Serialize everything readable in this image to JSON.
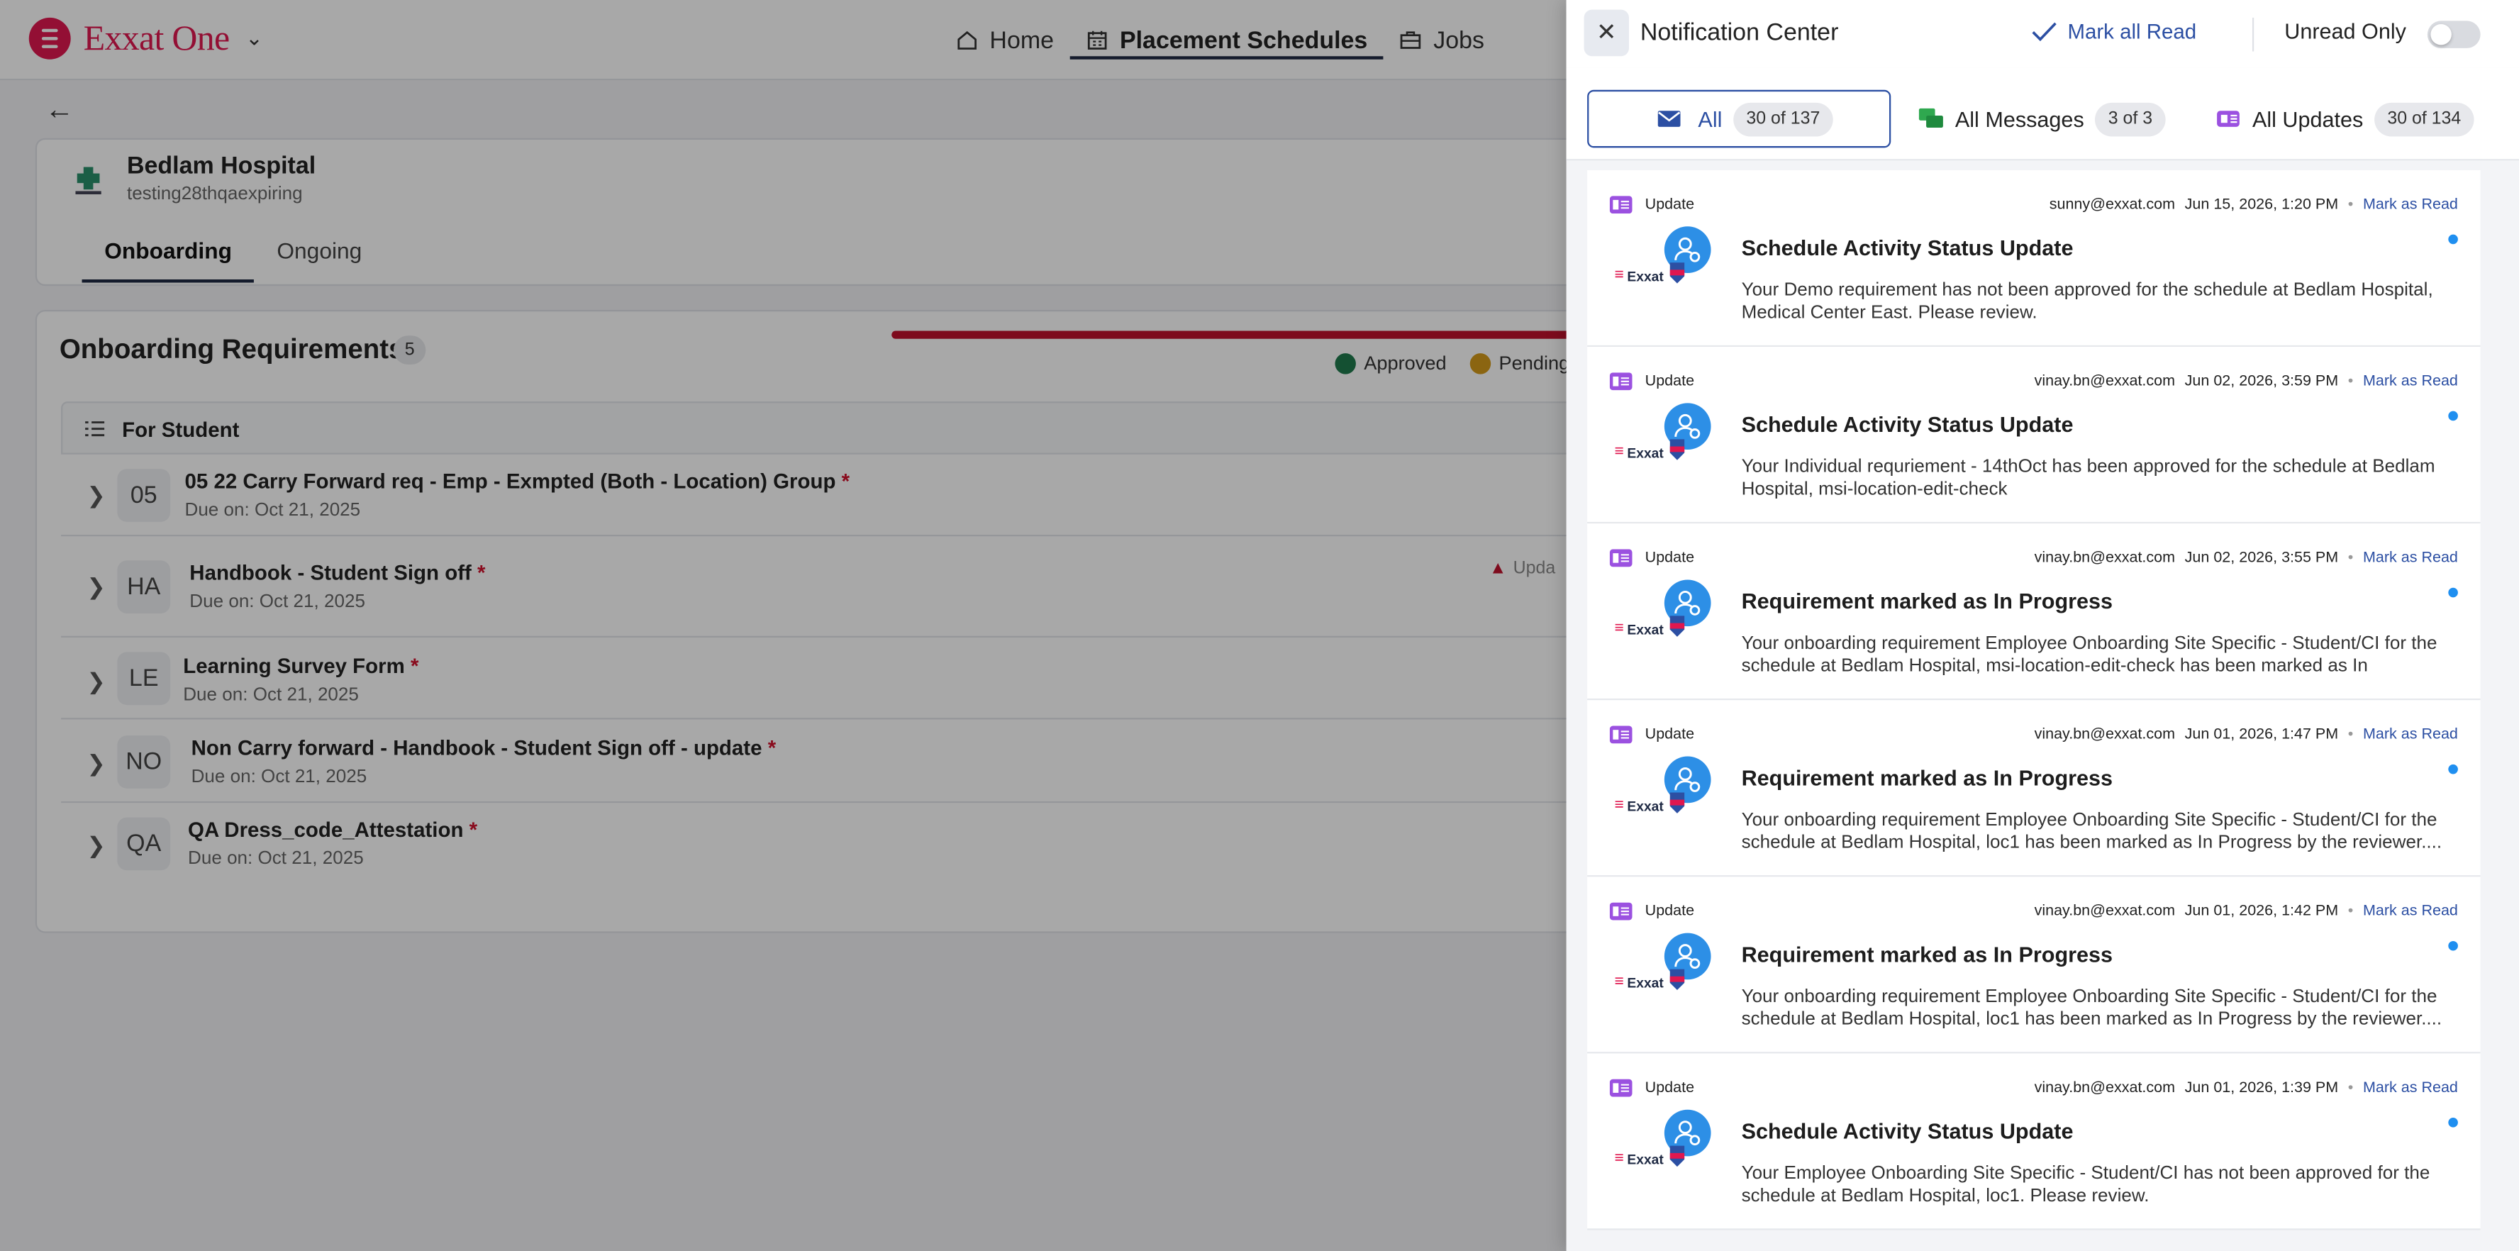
{
  "app": {
    "name": "Exxat One"
  },
  "nav": [
    {
      "label": "Home",
      "icon": "home-icon"
    },
    {
      "label": "Placement Schedules",
      "icon": "calendar-icon"
    },
    {
      "label": "Jobs",
      "icon": "briefcase-icon"
    }
  ],
  "hospital": {
    "name": "Bedlam Hospital",
    "subtitle": "testing28thqaexpiring"
  },
  "tabs": [
    {
      "label": "Onboarding"
    },
    {
      "label": "Ongoing"
    }
  ],
  "requirements": {
    "title": "Onboarding Requirements",
    "count": "5",
    "legend": {
      "approved": "Approved",
      "pending": "Pending"
    },
    "group_label": "For Student",
    "warning_text": "Upda",
    "items": [
      {
        "badge": "05",
        "name": "05 22 Carry Forward req - Emp - Exmpted (Both - Location) Group",
        "required": "*",
        "due": "Due on: Oct 21, 2025"
      },
      {
        "badge": "HA",
        "name": "Handbook - Student Sign off",
        "required": "*",
        "due": "Due on: Oct 21, 2025"
      },
      {
        "badge": "LE",
        "name": "Learning Survey Form",
        "required": "*",
        "due": "Due on: Oct 21, 2025"
      },
      {
        "badge": "NO",
        "name": "Non Carry forward - Handbook - Student Sign off - update",
        "required": "*",
        "due": "Due on: Oct 21, 2025"
      },
      {
        "badge": "QA",
        "name": "QA Dress_code_Attestation",
        "required": "*",
        "due": "Due on: Oct 21, 2025"
      }
    ]
  },
  "drawer": {
    "title": "Notification Center",
    "mark_all": "Mark all Read",
    "unread_only": "Unread Only",
    "unread_only_on": false,
    "filters": [
      {
        "label": "All",
        "count": "30 of 137",
        "active": true
      },
      {
        "label": "All Messages",
        "count": "3 of 3",
        "active": false
      },
      {
        "label": "All Updates",
        "count": "30 of 134",
        "active": false
      }
    ],
    "notifications": [
      {
        "type": "Update",
        "sender": "sunny@exxat.com",
        "time": "Jun 15, 2026, 1:20 PM",
        "action": "Mark as Read",
        "brand": "Exxat",
        "title": "Schedule Activity Status Update",
        "body": "Your Demo requirement has not been approved for the schedule at Bedlam Hospital, Medical Center East. Please review."
      },
      {
        "type": "Update",
        "sender": "vinay.bn@exxat.com",
        "time": "Jun 02, 2026, 3:59 PM",
        "action": "Mark as Read",
        "brand": "Exxat",
        "title": "Schedule Activity Status Update",
        "body": "Your Individual requriement - 14thOct has been approved for the schedule at Bedlam Hospital, msi-location-edit-check"
      },
      {
        "type": "Update",
        "sender": "vinay.bn@exxat.com",
        "time": "Jun 02, 2026, 3:55 PM",
        "action": "Mark as Read",
        "brand": "Exxat",
        "title": "Requirement marked as In Progress",
        "body": "Your onboarding requirement Employee Onboarding Site Specific - Student/CI for the schedule at Bedlam Hospital, msi-location-edit-check has been marked as In Progress..."
      },
      {
        "type": "Update",
        "sender": "vinay.bn@exxat.com",
        "time": "Jun 01, 2026, 1:47 PM",
        "action": "Mark as Read",
        "brand": "Exxat",
        "title": "Requirement marked as In Progress",
        "body": "Your onboarding requirement Employee Onboarding Site Specific - Student/CI for the schedule at Bedlam Hospital, loc1 has been marked as In Progress by the reviewer...."
      },
      {
        "type": "Update",
        "sender": "vinay.bn@exxat.com",
        "time": "Jun 01, 2026, 1:42 PM",
        "action": "Mark as Read",
        "brand": "Exxat",
        "title": "Requirement marked as In Progress",
        "body": "Your onboarding requirement Employee Onboarding Site Specific - Student/CI for the schedule at Bedlam Hospital, loc1 has been marked as In Progress by the reviewer...."
      },
      {
        "type": "Update",
        "sender": "vinay.bn@exxat.com",
        "time": "Jun 01, 2026, 1:39 PM",
        "action": "Mark as Read",
        "brand": "Exxat",
        "title": "Schedule Activity Status Update",
        "body": "Your Employee Onboarding Site Specific - Student/CI has not been approved for the schedule at Bedlam Hospital, loc1. Please review."
      }
    ]
  },
  "colors": {
    "brand": "#e0174f",
    "accent": "#2c4fa3",
    "unread_dot": "#1f8ff0",
    "approved": "#1f7a4d",
    "pending": "#d39a1a",
    "progress": "#c0122c"
  }
}
